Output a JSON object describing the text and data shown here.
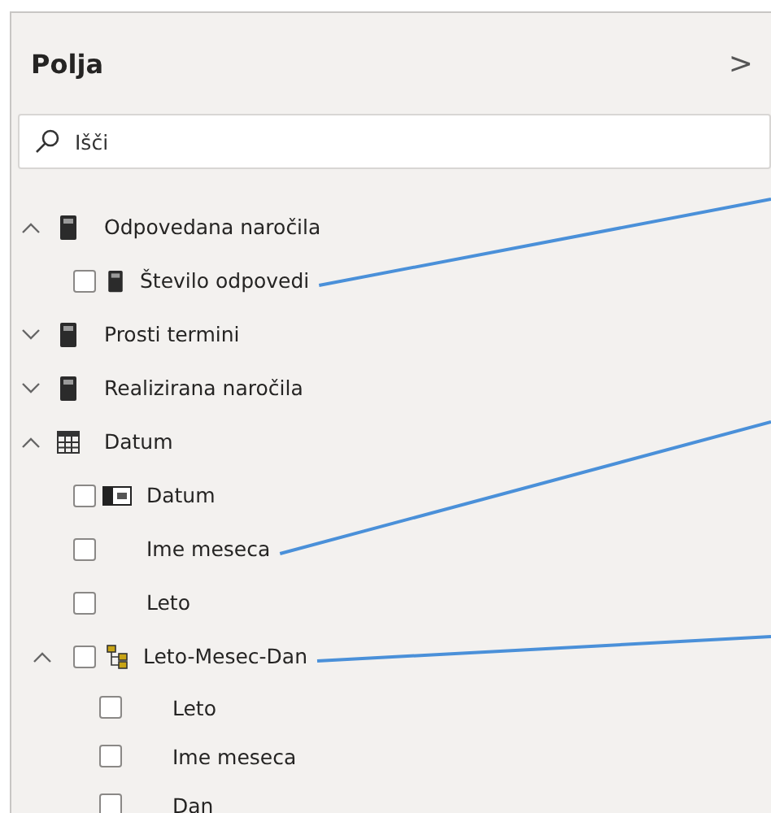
{
  "panel": {
    "title": "Polja",
    "collapse_glyph": ">"
  },
  "search": {
    "placeholder": "Išči"
  },
  "tables": [
    {
      "name": "Odpovedana naročila",
      "kind": "measure-table",
      "expanded": true,
      "children": [
        {
          "name": "Število odpovedi",
          "kind": "measure",
          "checked": false,
          "callout": true
        }
      ]
    },
    {
      "name": "Prosti termini",
      "kind": "measure-table",
      "expanded": false
    },
    {
      "name": "Realizirana naročila",
      "kind": "measure-table",
      "expanded": false
    },
    {
      "name": "Datum",
      "kind": "table",
      "expanded": true,
      "children": [
        {
          "name": "Datum",
          "kind": "date",
          "checked": false,
          "callout": false
        },
        {
          "name": "Ime meseca",
          "kind": "column",
          "checked": false,
          "callout": true
        },
        {
          "name": "Leto",
          "kind": "column",
          "checked": false,
          "callout": false
        },
        {
          "name": "Leto-Mesec-Dan",
          "kind": "hierarchy",
          "checked": false,
          "expanded": true,
          "callout": true,
          "children": [
            {
              "name": "Leto",
              "checked": false
            },
            {
              "name": "Ime meseca",
              "checked": false
            },
            {
              "name": "Dan",
              "checked": false
            }
          ]
        }
      ]
    }
  ]
}
